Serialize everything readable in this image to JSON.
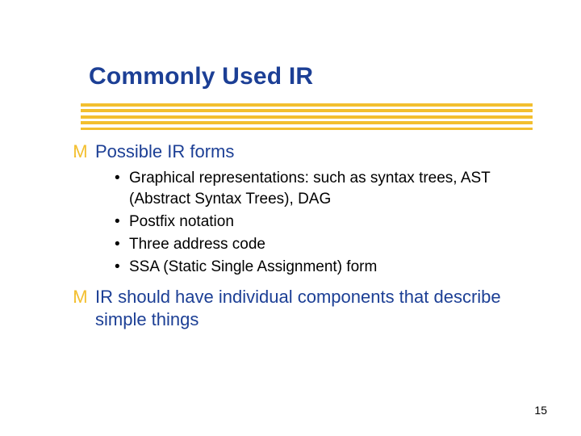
{
  "title": "Commonly Used IR",
  "bullets": {
    "marker_main": ": M",
    "marker_sub": "•",
    "item1": {
      "text": "Possible IR forms",
      "subs": {
        "a": "Graphical representations: such as syntax trees, AST (Abstract Syntax Trees), DAG",
        "b": "Postfix notation",
        "c": "Three address code",
        "d": "SSA (Static Single Assignment) form"
      }
    },
    "item2": {
      "text": "IR should have individual components that describe simple things"
    }
  },
  "page_number": "15"
}
